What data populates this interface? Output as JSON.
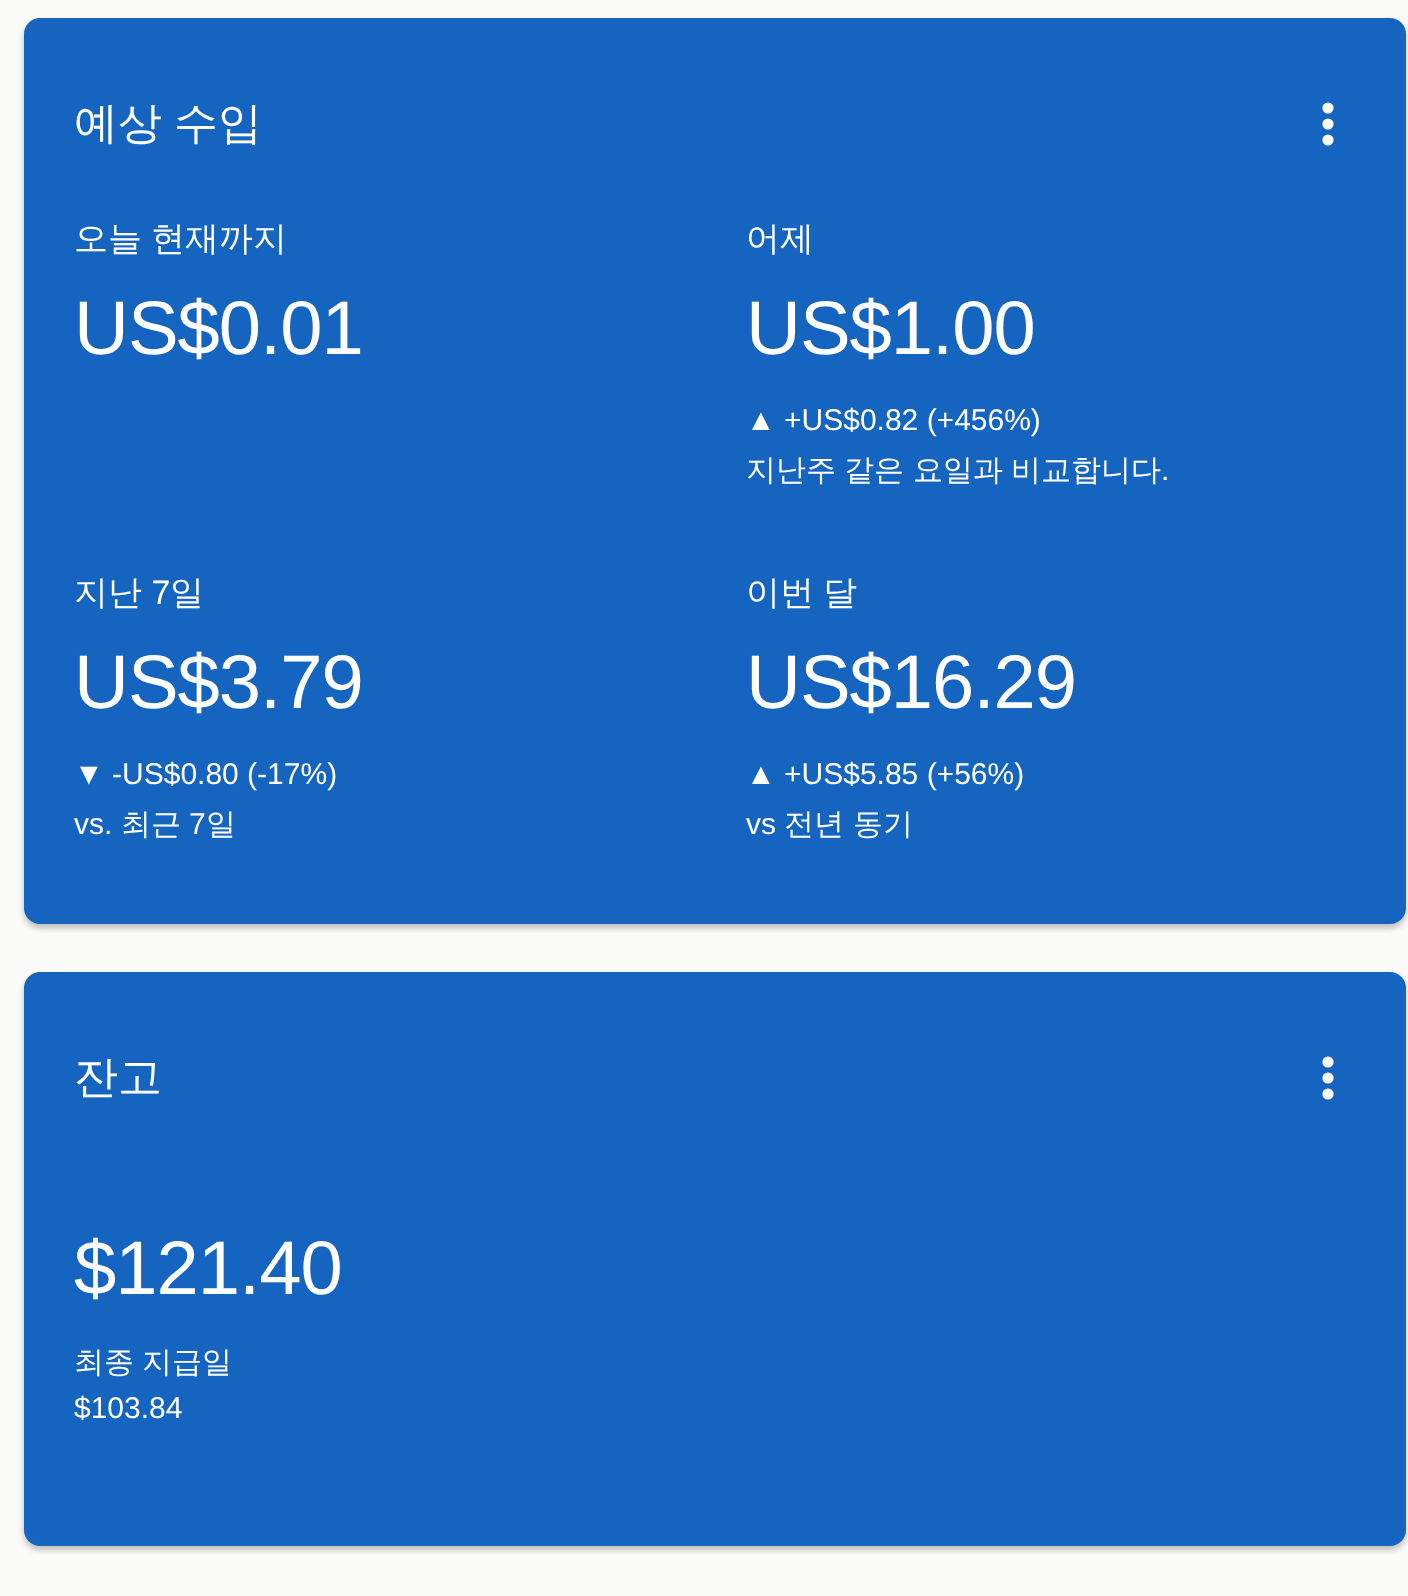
{
  "estimated_earnings": {
    "title": "예상 수입",
    "metrics": [
      {
        "label": "오늘 현재까지",
        "value": "US$0.01"
      },
      {
        "label": "어제",
        "value": "US$1.00",
        "change": "▲ +US$0.82 (+456%)",
        "comparison": "지난주 같은 요일과 비교합니다."
      },
      {
        "label": "지난 7일",
        "value": "US$3.79",
        "change": "▼ -US$0.80 (-17%)",
        "comparison": "vs. 최근 7일"
      },
      {
        "label": "이번 달",
        "value": "US$16.29",
        "change": "▲ +US$5.85 (+56%)",
        "comparison": "vs 전년 동기"
      }
    ]
  },
  "balance": {
    "title": "잔고",
    "value": "$121.40",
    "last_payment_label": "최종 지급일",
    "last_payment_amount": "$103.84"
  }
}
